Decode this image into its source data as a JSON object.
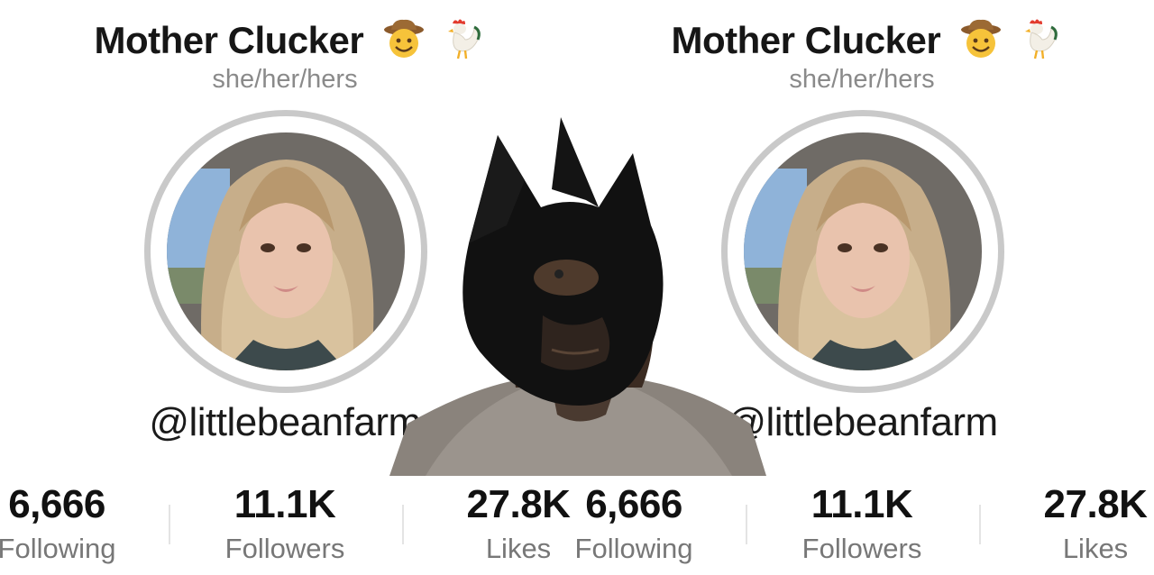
{
  "profile": {
    "display_name": "Mother Clucker",
    "pronouns": "she/her/hers",
    "handle": "@littlebeanfarm",
    "stats": {
      "following_value": "6,666",
      "following_label": "Following",
      "followers_value": "11.1K",
      "followers_label": "Followers",
      "likes_value": "27.8K",
      "likes_label": "Likes"
    }
  },
  "icons": {
    "name_emoji_1": "cowboy-face-icon",
    "name_emoji_2": "rooster-icon"
  },
  "colors": {
    "ring": "#c9c9c9",
    "secondary_text": "#8a8a8a"
  }
}
